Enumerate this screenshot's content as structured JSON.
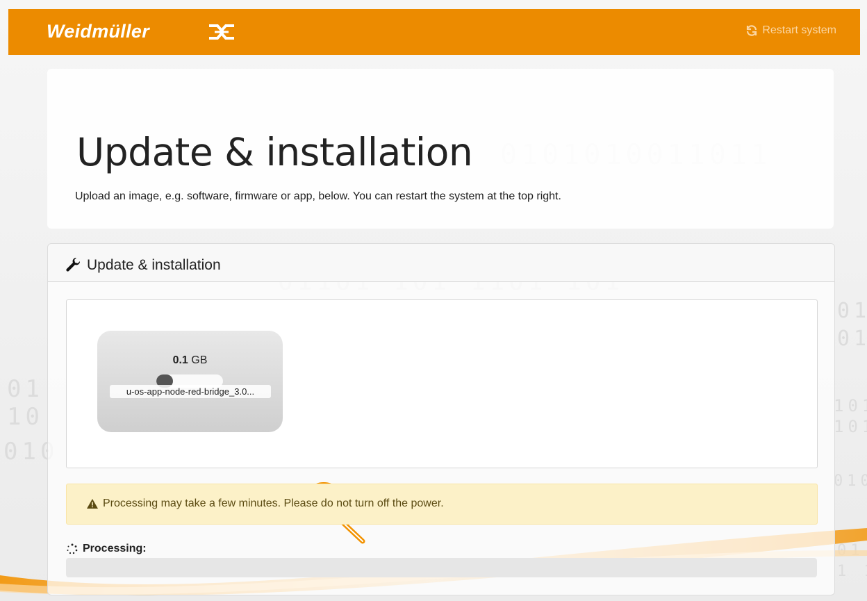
{
  "header": {
    "brand": "Weidmüller",
    "restart_label": "Restart system"
  },
  "hero": {
    "title": "Update & installation",
    "subtitle": "Upload an image, e.g. software, firmware or app, below. You can restart the system at the top right."
  },
  "card": {
    "title": "Update & installation",
    "file": {
      "size_value": "0.1",
      "size_unit": "GB",
      "name": "u-os-app-node-red-bridge_3.0...",
      "upload_progress": 0.25
    },
    "alert_text": "Processing may take a few minutes. Please do not turn off the power.",
    "processing_label": "Processing:",
    "processing_progress": 0
  },
  "colors": {
    "brand_orange": "#ec8b00",
    "alert_bg": "#fcf1c8",
    "magnifier": "#f29200"
  },
  "icons": {
    "restart": "sync-icon",
    "card_title": "wrench-icon",
    "alert": "warning-triangle-icon",
    "processing": "spinner-icon",
    "cursor": "magnifier-icon"
  }
}
